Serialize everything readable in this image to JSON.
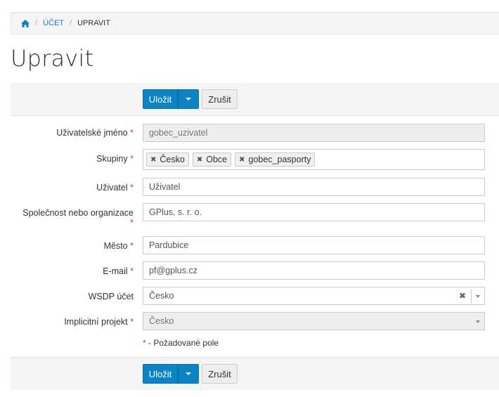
{
  "breadcrumb": {
    "items": [
      {
        "label": "ÚČET"
      },
      {
        "label": "UPRAVIT"
      }
    ],
    "separator": "/"
  },
  "page": {
    "title": "Upravit"
  },
  "actions": {
    "save_label": "Uložit",
    "cancel_label": "Zrušit"
  },
  "form": {
    "required_mark": "*",
    "username": {
      "label": "Uživatelské jméno",
      "value": "gobec_uzivatel"
    },
    "groups": {
      "label": "Skupiny",
      "tags": [
        "Česko",
        "Obce",
        "gobec_pasporty"
      ],
      "remove_glyph": "✖"
    },
    "user": {
      "label": "Uživatel",
      "value": "Uživatel"
    },
    "company": {
      "label": "Společnost nebo organizace",
      "value": "GPlus, s. r. o."
    },
    "city": {
      "label": "Město",
      "value": "Pardubice"
    },
    "email": {
      "label": "E-mail",
      "value": "pf@gplus.cz"
    },
    "wsdp": {
      "label": "WSDP účet",
      "value": "Česko",
      "clear_glyph": "✖"
    },
    "project": {
      "label": "Implicitní projekt",
      "value": "Česko"
    },
    "required_note": "- Požadované pole"
  },
  "colors": {
    "primary": "#0b84c5",
    "required": "#d43f3a",
    "link": "#0b7fc7"
  }
}
